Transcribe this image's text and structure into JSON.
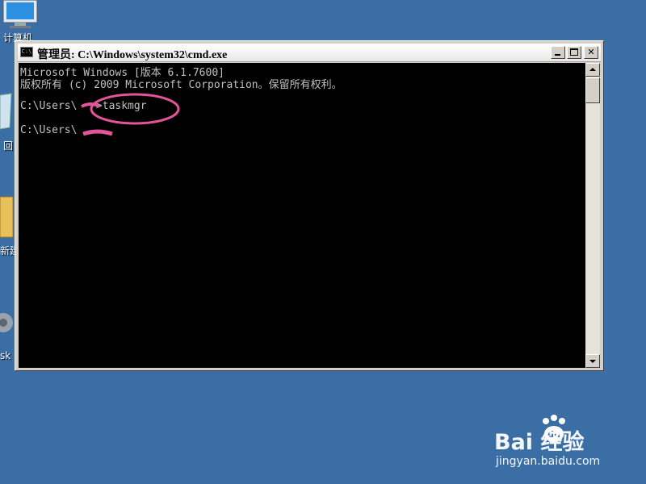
{
  "desktop": {
    "icons": [
      {
        "label": "计算机"
      },
      {
        "label": "回"
      },
      {
        "label": "新建"
      },
      {
        "label": "sk"
      }
    ]
  },
  "window": {
    "title": "管理员: C:\\Windows\\system32\\cmd.exe",
    "icon_text": "C:\\",
    "buttons": {
      "minimize": "",
      "maximize": "",
      "close": "✕"
    }
  },
  "console": {
    "lines": [
      "Microsoft Windows [版本 6.1.7600]",
      "版权所有 (c) 2009 Microsoft Corporation。保留所有权利。",
      "C:\\Users\\   >taskmgr",
      "C:\\Users\\"
    ]
  },
  "annotation_color": "#e2559a",
  "watermark": {
    "logo": "Bai  经验",
    "url": "jingyan.baidu.com"
  }
}
